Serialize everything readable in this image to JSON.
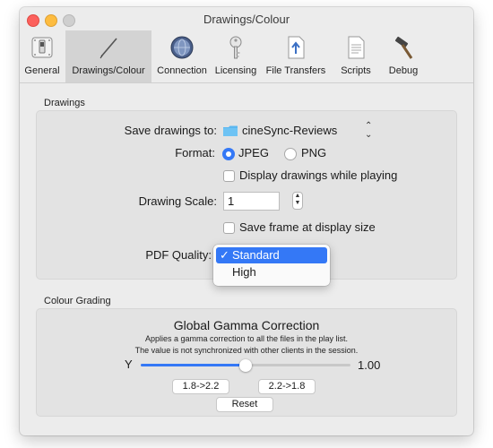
{
  "window": {
    "title": "Drawings/Colour"
  },
  "toolbar": {
    "items": [
      {
        "label": "General",
        "icon": "switch-icon"
      },
      {
        "label": "Drawings/Colour",
        "icon": "pencil-icon"
      },
      {
        "label": "Connection",
        "icon": "globe-icon"
      },
      {
        "label": "Licensing",
        "icon": "key-icon"
      },
      {
        "label": "File Transfers",
        "icon": "upload-icon"
      },
      {
        "label": "Scripts",
        "icon": "document-icon"
      },
      {
        "label": "Debug",
        "icon": "hammer-icon"
      }
    ],
    "selected": "Drawings/Colour"
  },
  "drawings": {
    "section_title": "Drawings",
    "save_label": "Save drawings to:",
    "save_folder": "cineSync-Reviews",
    "format_label": "Format:",
    "format_options": [
      "JPEG",
      "PNG"
    ],
    "format_selected": "JPEG",
    "display_while_playing": "Display drawings while playing",
    "scale_label": "Drawing Scale:",
    "scale_value": "1",
    "save_frame_label": "Save frame at display size",
    "pdf_label": "PDF Quality:",
    "pdf_options": [
      "Standard",
      "High"
    ],
    "pdf_selected": "Standard",
    "check_mark": "✓"
  },
  "colour": {
    "section_title": "Colour Grading",
    "title": "Global Gamma Correction",
    "desc1": "Applies a gamma correction to all the files in the play list.",
    "desc2": "The value is not synchronized with other clients in the session.",
    "y_label": "Y",
    "value": "1.00",
    "slider_fraction": 0.5,
    "btn_a": "1.8->2.2",
    "btn_b": "2.2->1.8",
    "reset": "Reset"
  },
  "colors": {
    "accent": "#3478f6",
    "folder": "#5bb7f0"
  }
}
